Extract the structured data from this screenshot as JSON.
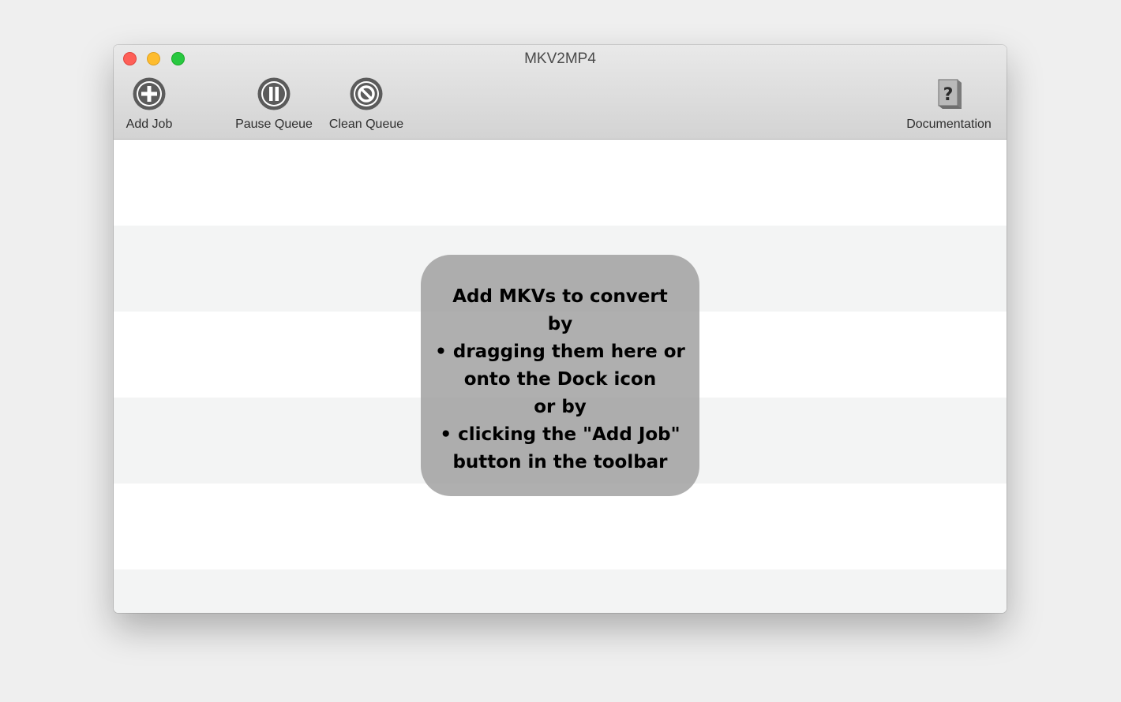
{
  "window": {
    "title": "MKV2MP4"
  },
  "toolbar": {
    "add_job": {
      "label": "Add Job",
      "icon": "plus-circle-icon"
    },
    "pause_queue": {
      "label": "Pause Queue",
      "icon": "pause-circle-icon"
    },
    "clean_queue": {
      "label": "Clean Queue",
      "icon": "no-entry-circle-icon"
    },
    "documentation": {
      "label": "Documentation",
      "icon": "help-book-icon"
    }
  },
  "queue": {
    "empty_hint": {
      "lines": [
        "Add MKVs to convert",
        "by",
        "• dragging them here or",
        "onto the Dock icon",
        "or by",
        "• clicking the \"Add Job\"",
        "button in the toolbar"
      ]
    }
  },
  "colors": {
    "close": "#fe5f57",
    "minimize": "#febc2e",
    "zoom": "#28c840",
    "row_alt": "#f3f4f4",
    "hint_bg": "#9e9e9e"
  }
}
